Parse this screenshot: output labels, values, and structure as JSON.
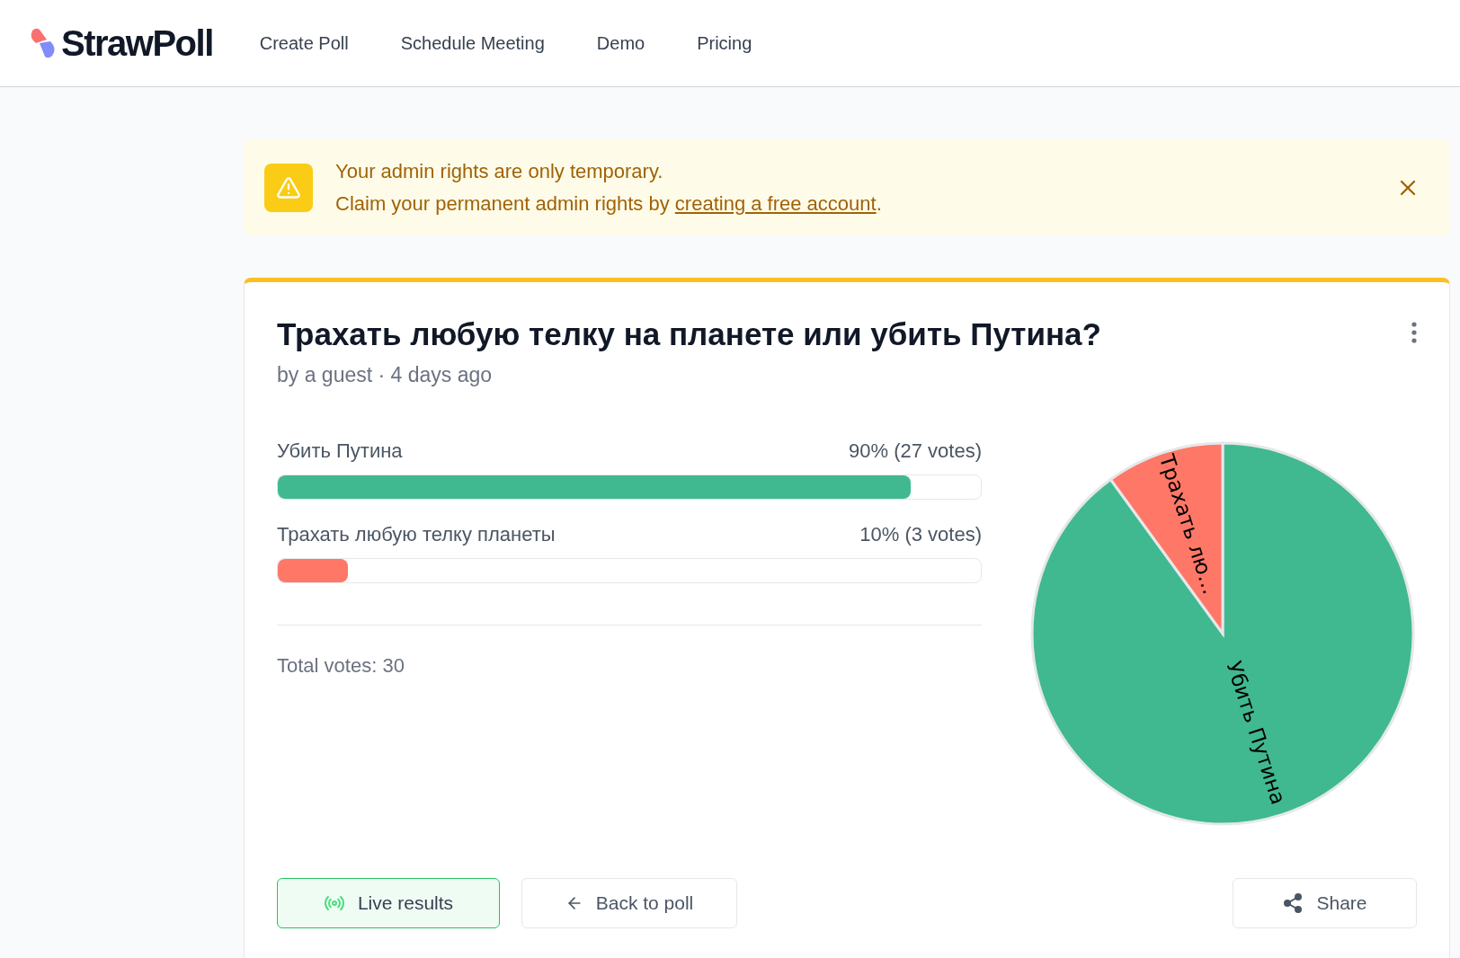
{
  "header": {
    "logo": "StrawPoll",
    "nav": [
      "Create Poll",
      "Schedule Meeting",
      "Demo",
      "Pricing"
    ]
  },
  "banner": {
    "line1": "Your admin rights are only temporary.",
    "line2_before": "Claim your permanent admin rights by",
    "link": "creating a free account",
    "line2_after": "."
  },
  "poll": {
    "title": "Трахать любую телку на планете или убить Путина?",
    "meta": "by a guest · 4 days ago",
    "options": [
      {
        "label": "Убить Путина",
        "result": "90% (27 votes)",
        "level": 0.9,
        "color": "#40b990"
      },
      {
        "label": "Трахать любую телку планеты",
        "result": "10% (3 votes)",
        "level": 0.1,
        "color": "#ff7767"
      }
    ],
    "total": "Total votes: 30",
    "chart_data": {
      "type": "pie",
      "categories": [
        "Убить Путина",
        "Трахать лю…"
      ],
      "values": [
        90,
        10
      ]
    },
    "buttons": [
      "Live results",
      "Back to poll",
      "Share"
    ]
  }
}
